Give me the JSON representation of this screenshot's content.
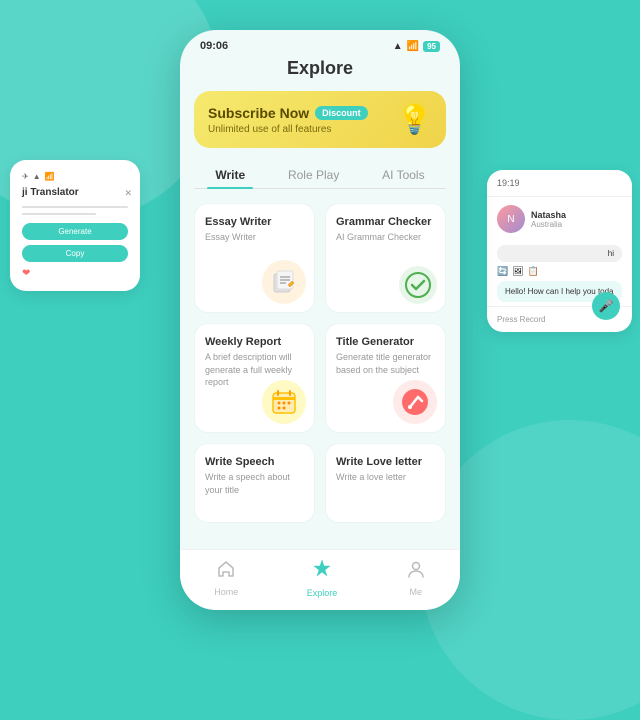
{
  "status_bar": {
    "time": "09:06",
    "battery": "95"
  },
  "page": {
    "title": "Explore"
  },
  "banner": {
    "title": "Subscribe Now",
    "badge": "Discount",
    "subtitle": "Unlimited use of all features"
  },
  "tabs": [
    {
      "label": "Write",
      "active": true
    },
    {
      "label": "Role Play",
      "active": false
    },
    {
      "label": "AI Tools",
      "active": false
    }
  ],
  "tools": [
    {
      "title": "Essay Writer",
      "desc": "Essay Writer",
      "icon_type": "essay"
    },
    {
      "title": "Grammar Checker",
      "desc": "AI Grammar Checker",
      "icon_type": "grammar"
    },
    {
      "title": "Weekly Report",
      "desc": "A brief description will generate a full weekly report",
      "icon_type": "calendar"
    },
    {
      "title": "Title Generator",
      "desc": "Generate title generator based on the subject",
      "icon_type": "pen"
    },
    {
      "title": "Write Speech",
      "desc": "Write a speech about your title",
      "icon_type": "speech"
    },
    {
      "title": "Write Love letter",
      "desc": "Write a love letter",
      "icon_type": "letter"
    }
  ],
  "bottom_nav": [
    {
      "label": "Home",
      "icon": "🏠",
      "active": false
    },
    {
      "label": "Explore",
      "icon": "✦",
      "active": true
    },
    {
      "label": "Me",
      "icon": "👤",
      "active": false
    }
  ],
  "side_left": {
    "title": "ji Translator"
  },
  "side_right": {
    "time": "19:19",
    "user_name": "Natasha",
    "user_country": "Australia",
    "hi_msg": "hi",
    "bot_msg": "Hello! How can I help you toda",
    "press_record": "Press Record"
  }
}
